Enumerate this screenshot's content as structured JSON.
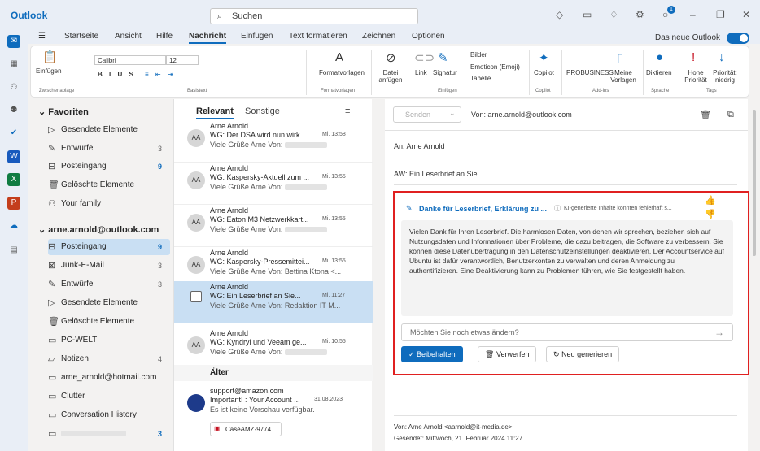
{
  "titlebar": {
    "app_name": "Outlook",
    "search_placeholder": "Suchen",
    "notification_count": "1"
  },
  "ribbon_tabs": [
    "Startseite",
    "Ansicht",
    "Hilfe",
    "Nachricht",
    "Einfügen",
    "Text formatieren",
    "Zeichnen",
    "Optionen"
  ],
  "new_outlook_label": "Das neue Outlook",
  "ribbon": {
    "paste": "Einfügen",
    "font_name": "Calibri",
    "font_size": "12",
    "group_clipboard": "Zwischenablage",
    "group_basic": "Basistext",
    "format_templates": "Formatvorlagen",
    "group_format": "Formatvorlagen",
    "attach_file": "Datei anfügen",
    "link": "Link",
    "signature": "Signatur",
    "pictures": "Bilder",
    "emoticon": "Emoticon (Emoji)",
    "table": "Tabelle",
    "group_insert": "Einfügen",
    "copilot": "Copilot",
    "group_copilot": "Copilot",
    "probusiness": "PROBUSINESS",
    "my_templates": "Meine Vorlagen",
    "group_addins": "Add-ins",
    "dictate": "Diktieren",
    "group_voice": "Sprache",
    "high_priority": "Hohe Priorität",
    "low_priority": "Priorität: niedrig",
    "group_tags": "Tags"
  },
  "folders": {
    "favorites_title": "Favoriten",
    "favorites": [
      {
        "label": "Gesendete Elemente",
        "count": ""
      },
      {
        "label": "Entwürfe",
        "count": "3"
      },
      {
        "label": "Posteingang",
        "count": "9"
      },
      {
        "label": "Gelöschte Elemente",
        "count": ""
      },
      {
        "label": "Your family",
        "count": ""
      }
    ],
    "account_title": "arne.arnold@outlook.com",
    "account": [
      {
        "label": "Posteingang",
        "count": "9"
      },
      {
        "label": "Junk-E-Mail",
        "count": "3"
      },
      {
        "label": "Entwürfe",
        "count": "3"
      },
      {
        "label": "Gesendete Elemente",
        "count": ""
      },
      {
        "label": "Gelöschte Elemente",
        "count": ""
      },
      {
        "label": "PC-WELT",
        "count": ""
      },
      {
        "label": "Notizen",
        "count": "4"
      },
      {
        "label": "arne_arnold@hotmail.com",
        "count": ""
      },
      {
        "label": "Clutter",
        "count": ""
      },
      {
        "label": "Conversation History",
        "count": ""
      },
      {
        "label": "",
        "count": "3"
      }
    ]
  },
  "msglist": {
    "tab_relevant": "Relevant",
    "tab_other": "Sonstige",
    "messages": [
      {
        "from": "Arne Arnold",
        "subject": "WG: Der DSA wird nun wirk...",
        "time": "Mi. 13:58",
        "preview": "Viele Grüße Arne Von:",
        "initials": "AA"
      },
      {
        "from": "Arne Arnold",
        "subject": "WG: Kaspersky-Aktuell zum ...",
        "time": "Mi. 13:55",
        "preview": "Viele Grüße Arne Von:",
        "initials": "AA"
      },
      {
        "from": "Arne Arnold",
        "subject": "WG: Eaton M3 Netzwerkkart...",
        "time": "Mi. 13:55",
        "preview": "Viele Grüße Arne Von:",
        "initials": "AA"
      },
      {
        "from": "Arne Arnold",
        "subject": "WG: Kaspersky-Pressemittei...",
        "time": "Mi. 13:55",
        "preview": "Viele Grüße Arne Von: Bettina Ktona <...",
        "initials": "AA"
      },
      {
        "from": "Arne Arnold",
        "subject": "WG: Ein Leserbrief an Sie...",
        "time": "Mi. 11:27",
        "preview": "Viele Grüße Arne Von: Redaktion IT M...",
        "initials": ""
      },
      {
        "from": "Arne Arnold",
        "subject": "WG: Kyndryl und Veeam ge...",
        "time": "Mi. 10:55",
        "preview": "Viele Grüße Arne Von:",
        "initials": "AA"
      }
    ],
    "older_label": "Älter",
    "older_message": {
      "from": "support@amazon.com",
      "subject": "Important! : Your Account ...",
      "time": "31.08.2023",
      "preview": "Es ist keine Vorschau verfügbar.",
      "attachment": "CaseAMZ-9774..."
    }
  },
  "reading": {
    "send": "Senden",
    "from": "Von: arne.arnold@outlook.com",
    "to": "An: Arne Arnold",
    "subject": "AW: Ein Leserbrief an Sie...",
    "footer_from": "Von: Arne Arnold <aarnold@it-media.de>",
    "footer_sent": "Gesendet: Mittwoch, 21. Februar 2024 11:27"
  },
  "copilot": {
    "title": "Danke für Leserbrief, Erklärung zu ...",
    "notice": "KI-generierte Inhalte könnten fehlerhaft s...",
    "body": "Vielen Dank für Ihren Leserbrief. Die harmlosen Daten, von denen wir sprechen, beziehen sich auf Nutzungsdaten und Informationen über Probleme, die dazu beitragen, die Software zu verbessern. Sie können diese Datenübertragung in den Datenschutzeinstellungen deaktivieren. Der Accountservice auf Ubuntu ist dafür verantwortlich, Benutzerkonten zu verwalten und deren Anmeldung zu authentifizieren. Eine Deaktivierung kann zu Problemen führen, wie Sie festgestellt haben.",
    "ask_placeholder": "Möchten Sie noch etwas ändern?",
    "keep": "Beibehalten",
    "discard": "Verwerfen",
    "regenerate": "Neu generieren"
  },
  "colors": {
    "accent": "#0f6cbd",
    "highlight": "#e02020"
  }
}
